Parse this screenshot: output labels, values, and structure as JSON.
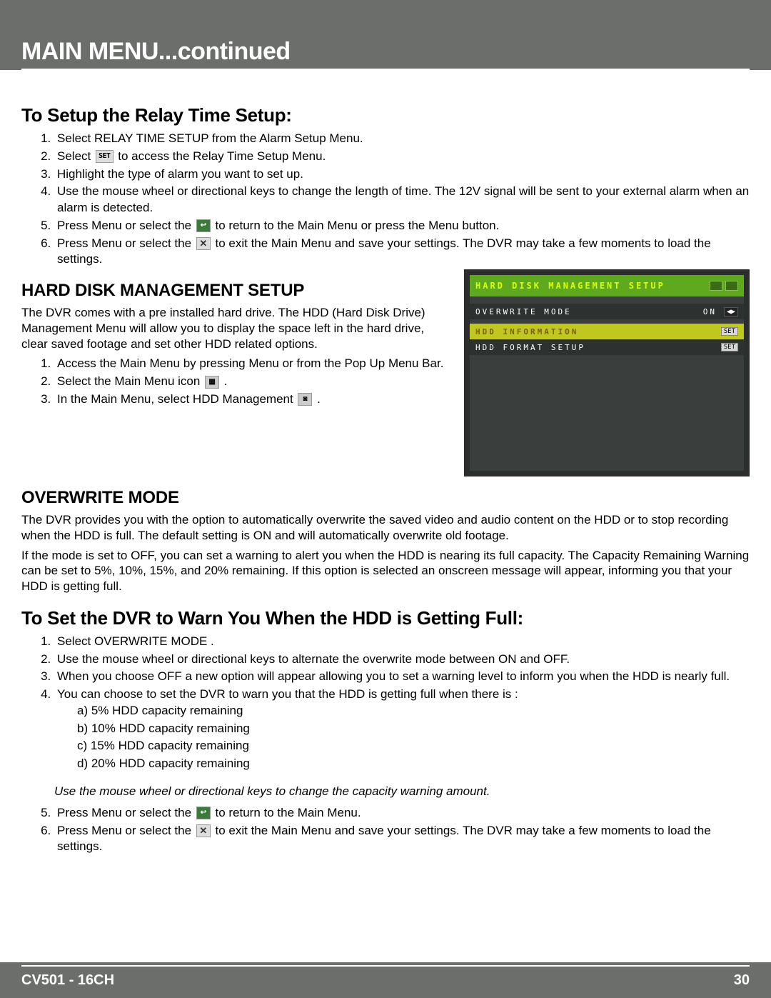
{
  "header": {
    "title": "MAIN MENU...continued"
  },
  "s1": {
    "heading": "To Setup the Relay Time Setup:",
    "li1": "Select RELAY TIME SETUP from the Alarm Setup Menu.",
    "li2a": "Select ",
    "set_label": "SET",
    "li2b": " to access the Relay Time Setup Menu.",
    "li3": "Highlight the type of alarm you want to set up.",
    "li4": "Use the mouse wheel or directional keys to change the length of time. The 12V signal will be sent to your external alarm when an alarm is detected.",
    "li5a": "Press Menu or select the  ",
    "back_glyph": "↩",
    "li5b": "  to return to the Main Menu or press the Menu button.",
    "li6a": "Press Menu or select the  ",
    "close_glyph": "✕",
    "li6b": "  to exit the Main Menu and save your settings. The DVR may take a few moments to load the settings."
  },
  "s2": {
    "heading": "HARD DISK MANAGEMENT SETUP",
    "intro": "The DVR comes with a pre installed hard drive. The HDD (Hard Disk Drive) Management Menu will allow you to display the space left in the hard drive, clear saved footage and set other HDD related options.",
    "li1": "Access the Main Menu by pressing Menu or from the Pop Up Menu Bar.",
    "li2a": "Select the Main Menu icon ",
    "menu_glyph": "▦",
    "li2b": "  .",
    "li3a": "In the Main Menu, select HDD Management ",
    "hdd_glyph": "◙",
    "li3b": "  ."
  },
  "dvr": {
    "title": "HARD DISK MANAGEMENT SETUP",
    "row1_label": "OVERWRITE MODE",
    "row1_value": "ON",
    "row2_label": "HDD INFORMATION",
    "row3_label": "HDD FORMAT SETUP",
    "set_btn": "SET"
  },
  "s3": {
    "heading": "OVERWRITE MODE",
    "p1": "The DVR provides you with the option to automatically overwrite the saved video and audio content on the HDD or to stop recording when the HDD is full. The default setting is ON and will automatically overwrite old footage.",
    "p2": "If the mode is set to OFF, you can set a warning to alert you when the HDD is nearing its full capacity. The Capacity Remaining Warning can be set to 5%, 10%, 15%, and 20% remaining. If this option is selected an onscreen message will appear, informing you that your HDD is getting full."
  },
  "s4": {
    "heading": "To Set the DVR to Warn You When the HDD is Getting Full:",
    "li1": "Select OVERWRITE MODE .",
    "li2": "Use the mouse wheel or directional keys to alternate the overwrite mode between ON and OFF.",
    "li3": "When you choose OFF a new option will appear allowing you to set a warning level to inform you when the HDD is nearly full.",
    "li4": "You can choose to set the DVR to warn you that the HDD is getting full when there is :",
    "sub_a": "a)      5% HDD capacity remaining",
    "sub_b": "b)    10% HDD capacity remaining",
    "sub_c": "c)    15% HDD capacity remaining",
    "sub_d": "d)    20% HDD capacity remaining",
    "note": "Use the mouse wheel or directional keys to change the capacity warning amount.",
    "li5a": "Press Menu or select the  ",
    "li5b": " to return to the Main Menu.",
    "li6a": "Press Menu or select the  ",
    "li6b": "  to exit the Main Menu and save your settings. The DVR may take a few moments to load the settings."
  },
  "footer": {
    "model": "CV501 - 16CH",
    "page": "30"
  }
}
